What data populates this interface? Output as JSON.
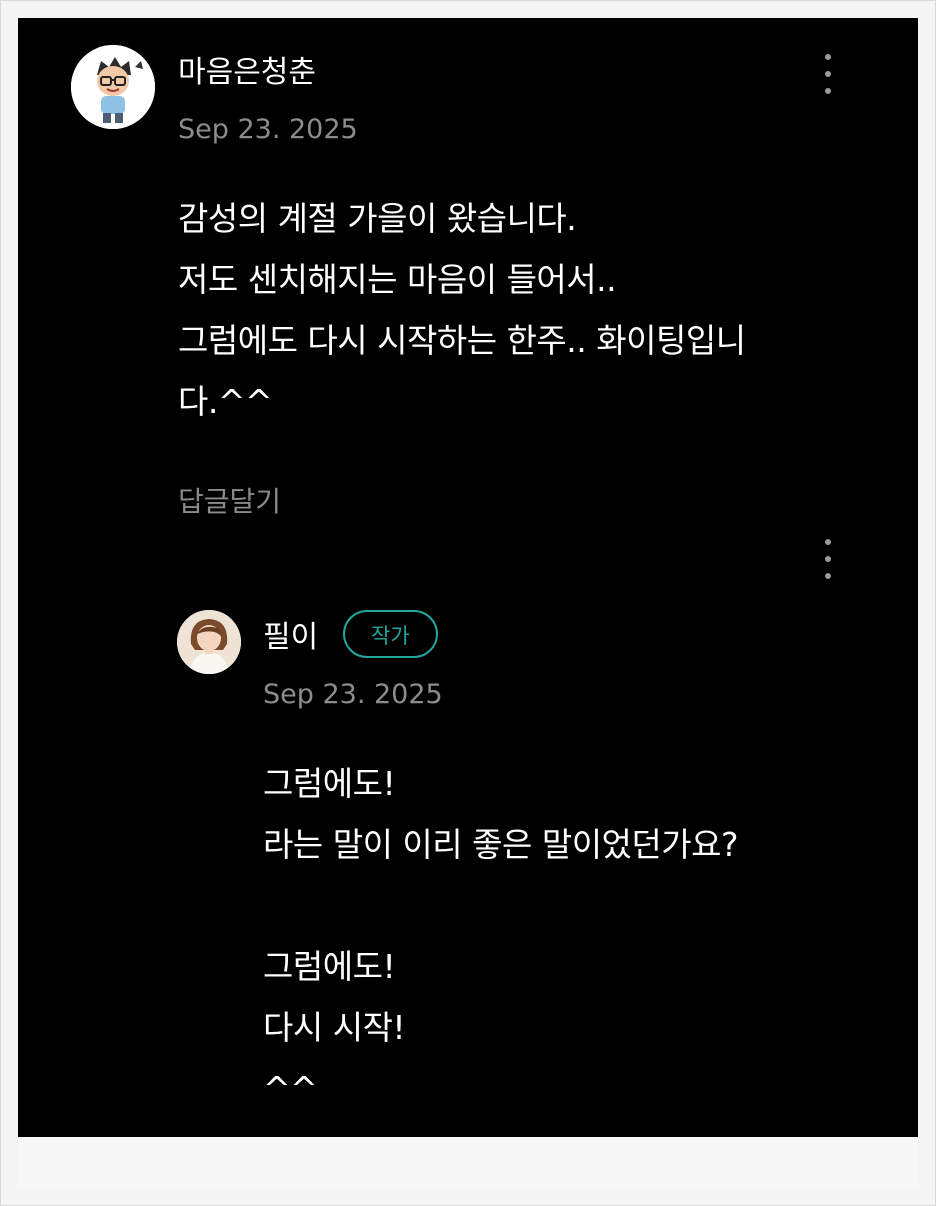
{
  "comment": {
    "author": "마음은청춘",
    "date": "Sep 23. 2025",
    "lines": [
      "감성의 계절 가을이 왔습니다.",
      "저도 센치해지는 마음이 들어서..",
      "그럼에도 다시 시작하는 한주.. 화이팅입니",
      "다.^^"
    ],
    "reply_label": "답글달기"
  },
  "reply": {
    "author": "필이",
    "badge": "작가",
    "date": "Sep 23. 2025",
    "lines": [
      "그럼에도!",
      "라는 말이 이리 좋은 말이었던가요?",
      "",
      "그럼에도!",
      "다시 시작!",
      "^^"
    ]
  },
  "icons": {
    "comment_menu": "more-vertical-icon",
    "reply_menu": "more-vertical-icon"
  },
  "colors": {
    "background": "#000000",
    "text": "#ffffff",
    "muted": "#8c8c8c",
    "badge_accent": "#22a79c"
  }
}
